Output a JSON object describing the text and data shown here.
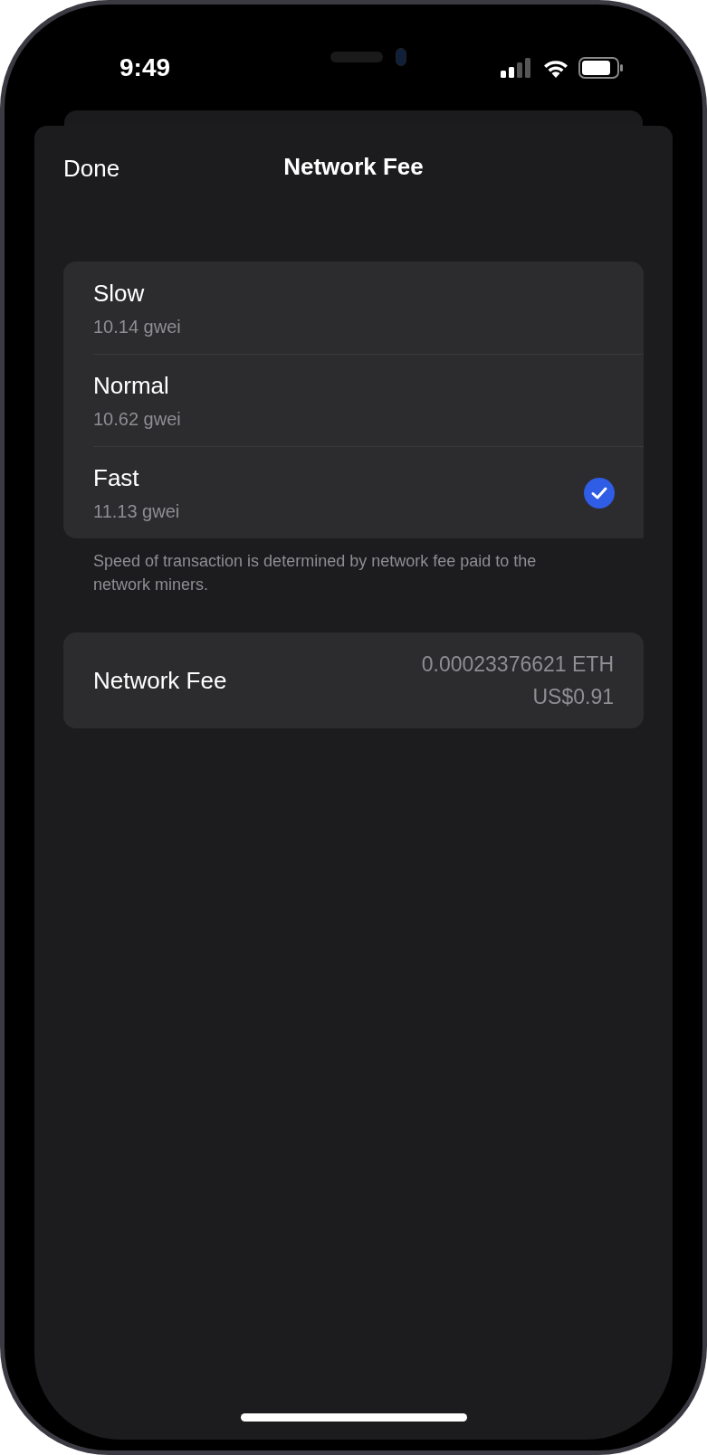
{
  "status_bar": {
    "time": "9:49"
  },
  "sheet": {
    "left_button": "Done",
    "title": "Network Fee"
  },
  "fee_options": [
    {
      "label": "Slow",
      "rate": "10.14 gwei",
      "selected": false
    },
    {
      "label": "Normal",
      "rate": "10.62 gwei",
      "selected": false
    },
    {
      "label": "Fast",
      "rate": "11.13 gwei",
      "selected": true
    }
  ],
  "footnote": "Speed of transaction is determined by network fee paid to the network miners.",
  "fee_summary": {
    "label": "Network Fee",
    "crypto_amount": "0.00023376621 ETH",
    "fiat_amount": "US$0.91"
  }
}
